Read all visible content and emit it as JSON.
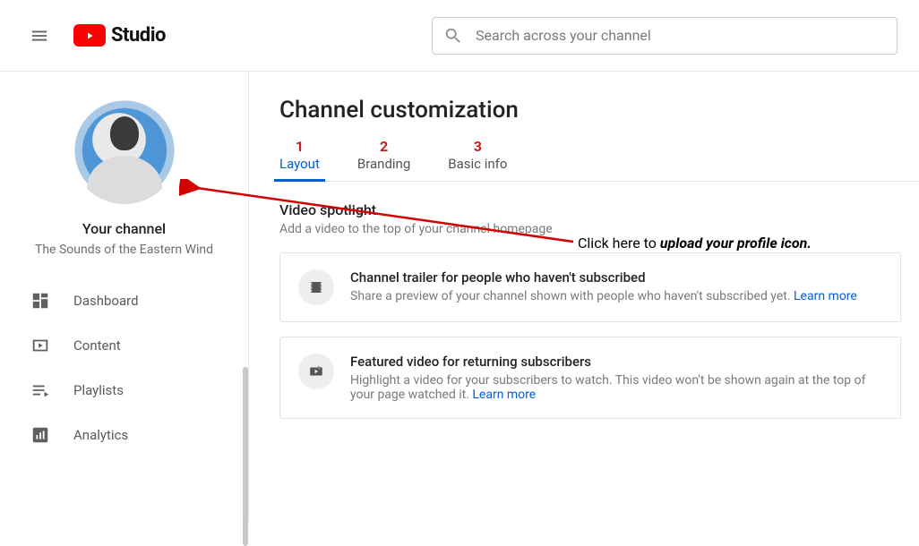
{
  "header": {
    "logo_text": "Studio",
    "search_placeholder": "Search across your channel"
  },
  "sidebar": {
    "your_channel_label": "Your channel",
    "channel_name": "The Sounds of the Eastern Wind",
    "nav": [
      {
        "label": "Dashboard"
      },
      {
        "label": "Content"
      },
      {
        "label": "Playlists"
      },
      {
        "label": "Analytics"
      }
    ]
  },
  "main": {
    "page_title": "Channel customization",
    "tabs": [
      {
        "num": "1",
        "label": "Layout"
      },
      {
        "num": "2",
        "label": "Branding"
      },
      {
        "num": "3",
        "label": "Basic info"
      }
    ],
    "spotlight": {
      "title": "Video spotlight",
      "subtitle": "Add a video to the top of your channel homepage"
    },
    "cards": [
      {
        "title": "Channel trailer for people who haven't subscribed",
        "sub": "Share a preview of your channel shown with people who haven't subscribed yet.  ",
        "link": "Learn more"
      },
      {
        "title": "Featured video for returning subscribers",
        "sub": "Highlight a video for your subscribers to watch. This video won't be shown again at the top of your page watched it.  ",
        "link": "Learn more"
      }
    ]
  },
  "annotation": {
    "prefix": "Click here to ",
    "bold": "upload your profile icon."
  }
}
